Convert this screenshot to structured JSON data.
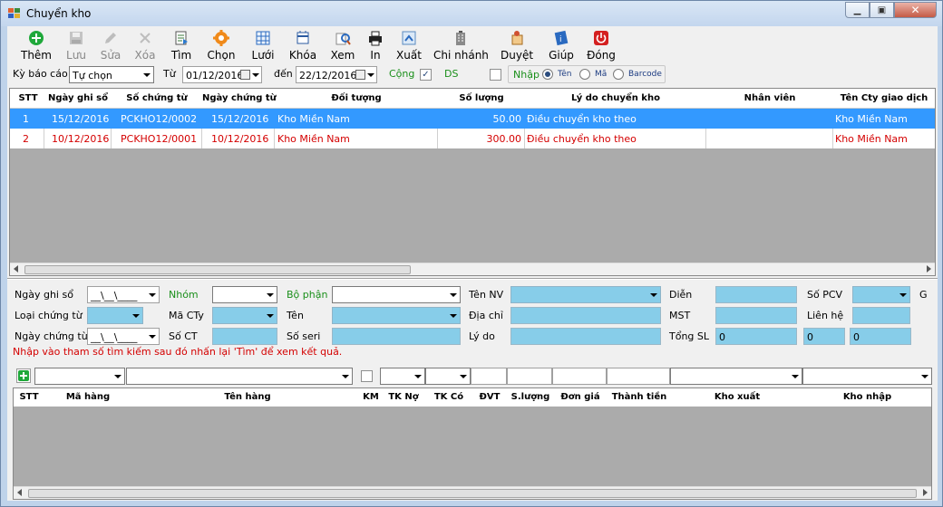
{
  "window": {
    "title": "Chuyển kho"
  },
  "toolbar": {
    "buttons": [
      {
        "label": "Thêm",
        "icon": "add-icon",
        "enabled": true
      },
      {
        "label": "Lưu",
        "icon": "save-icon",
        "enabled": false
      },
      {
        "label": "Sửa",
        "icon": "edit-icon",
        "enabled": false
      },
      {
        "label": "Xóa",
        "icon": "delete-icon",
        "enabled": false
      },
      {
        "label": "Tìm",
        "icon": "find-icon",
        "enabled": true
      },
      {
        "label": "Chọn",
        "icon": "gear-icon",
        "enabled": true
      },
      {
        "label": "Lưới",
        "icon": "grid-icon",
        "enabled": true
      },
      {
        "label": "Khóa",
        "icon": "lock-icon",
        "enabled": true
      },
      {
        "label": "Xem",
        "icon": "preview-icon",
        "enabled": true
      },
      {
        "label": "In",
        "icon": "printer-icon",
        "enabled": true
      },
      {
        "label": "Xuất",
        "icon": "export-icon",
        "enabled": true
      },
      {
        "label": "Chi nhánh",
        "icon": "branch-icon",
        "enabled": true
      },
      {
        "label": "Duyệt",
        "icon": "approve-icon",
        "enabled": true
      },
      {
        "label": "Giúp",
        "icon": "help-icon",
        "enabled": true
      },
      {
        "label": "Đóng",
        "icon": "power-icon",
        "enabled": true
      }
    ]
  },
  "filter": {
    "period_label": "Kỳ báo cáo",
    "period_value": "Tự chọn",
    "from_label": "Từ",
    "from_date": "01/12/2016",
    "to_label": "đến",
    "to_date": "22/12/2016",
    "cong_label": "Cộng",
    "cong_checked": true,
    "ds_label": "DS",
    "nhap_label": "Nhập",
    "search_by": [
      "Tên",
      "Mã",
      "Barcode"
    ],
    "search_selected": "Tên"
  },
  "grid": {
    "columns": [
      "STT",
      "Ngày ghi sổ",
      "Số chứng từ",
      "Ngày chứng từ",
      "Đối tượng",
      "Số lượng",
      "Lý do chuyển kho",
      "Nhân viên",
      "Tên Cty giao dịch"
    ],
    "rows": [
      {
        "stt": "1",
        "ngay_ghi_so": "15/12/2016",
        "so_chung_tu": "PCKHO12/0002",
        "ngay_chung_tu": "15/12/2016",
        "doi_tuong": "Kho Miền Nam",
        "so_luong": "50.00",
        "ly_do": "Điều chuyển kho theo",
        "nhan_vien": "",
        "ten_cty": "Kho Miền Nam"
      },
      {
        "stt": "2",
        "ngay_ghi_so": "10/12/2016",
        "so_chung_tu": "PCKHO12/0001",
        "ngay_chung_tu": "10/12/2016",
        "doi_tuong": "Kho Miền Nam",
        "so_luong": "300.00",
        "ly_do": "Điều chuyển kho theo",
        "nhan_vien": "",
        "ten_cty": "Kho Miền Nam"
      }
    ]
  },
  "form": {
    "ngay_ghi_so_label": "Ngày ghi sổ",
    "ngay_ghi_so_value": "__\\__\\____",
    "loai_chung_tu_label": "Loại chứng từ",
    "ngay_chung_tu_label": "Ngày chứng từ",
    "ngay_chung_tu_value": "__\\__\\____",
    "nhom_label": "Nhóm",
    "ma_cty_label": "Mã CTy",
    "so_ct_label": "Số CT",
    "bo_phan_label": "Bộ phận",
    "ten_label": "Tên",
    "so_seri_label": "Số seri",
    "ten_nv_label": "Tên NV",
    "dia_chi_label": "Địa chỉ",
    "ly_do_label": "Lý do",
    "dien_label": "Diễn",
    "mst_label": "MST",
    "tong_sl_label": "Tổng SL",
    "tong_sl_values": [
      "0",
      "0",
      "0"
    ],
    "so_pcv_label": "Số PCV",
    "lien_he_label": "Liên hệ",
    "g_label": "G",
    "hint": "Nhập vào tham số tìm kiếm sau đó nhấn lại 'Tìm' để xem kết quả."
  },
  "detail_grid": {
    "columns": [
      "STT",
      "Mã hàng",
      "Tên hàng",
      "KM",
      "TK Nợ",
      "TK Có",
      "ĐVT",
      "S.lượng",
      "Đơn giá",
      "Thành tiền",
      "Kho xuất",
      "Kho nhập"
    ]
  },
  "colors": {
    "selected_row": "#3399ff",
    "red_text": "#d40000",
    "field_blue": "#87cde9",
    "green_label": "#1a8f1a"
  }
}
